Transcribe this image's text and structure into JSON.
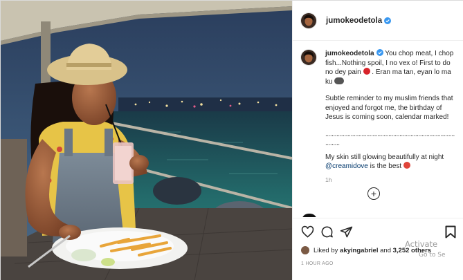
{
  "post": {
    "username": "jumokeodetola",
    "caption": {
      "line1": "You chop meat, I chop fish...Nothing spoil, I no vex o! First to do no dey pain",
      "line1_tail": ". Eran ma tan, eyan lo ma ku",
      "para2": "Subtle reminder to my muslim friends that enjoyed and forgot me, the birthday of Jesus is coming soon, calendar marked!",
      "dots": "..................................................................................",
      "dots2": ".........",
      "para3_pre": "My skin still glowing beautifully at night",
      "mention": "@creamidove",
      "para3_post": "is the best"
    },
    "comment_time": "1h",
    "liked_by": {
      "prefix": "Liked by",
      "user": "akyingabriel",
      "middle": "and",
      "count": "3,252 others"
    },
    "posted_time": "1 HOUR AGO"
  },
  "icons": {
    "verified": "verified-badge-icon",
    "like": "heart-icon",
    "comment": "comment-bubble-icon",
    "share": "paper-plane-icon",
    "save": "bookmark-icon",
    "load_more": "plus-circle-icon"
  },
  "colors": {
    "verified_blue": "#3897f0",
    "mention": "#00376b",
    "muted": "#8e8e8e"
  },
  "watermark": {
    "line1": "Activate",
    "line2": "Go to Se"
  }
}
